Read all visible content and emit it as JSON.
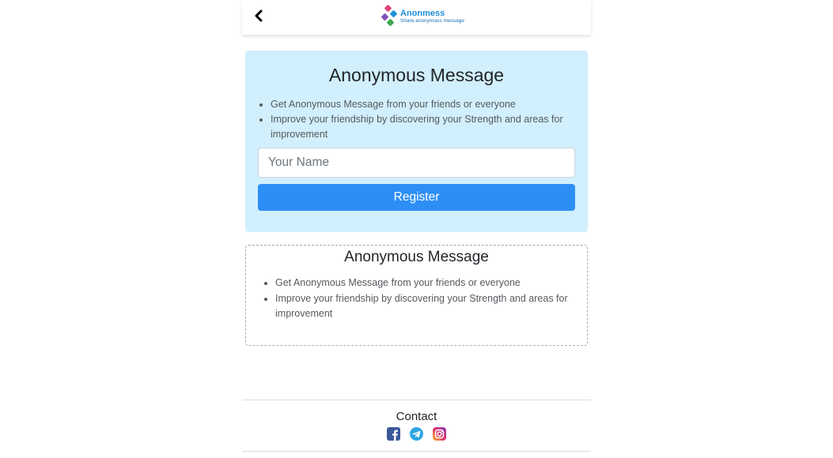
{
  "header": {
    "back_icon": "chevron-left-icon",
    "logo_name": "Anonmess",
    "logo_tagline": "Share anonymous message"
  },
  "register_card": {
    "title": "Anonymous Message",
    "bullets": [
      "Get Anonymous Message from your friends or everyone",
      "Improve your friendship by discovering your Strength and areas for improvement"
    ],
    "name_input": {
      "placeholder": "Your Name",
      "value": ""
    },
    "register_label": "Register",
    "background": "#d1effc",
    "button_color": "#2d8ff6"
  },
  "info_card": {
    "title": "Anonymous Message",
    "bullets": [
      "Get Anonymous Message from your friends or everyone",
      "Improve your friendship by discovering your Strength and areas for improvement"
    ]
  },
  "footer": {
    "contact_label": "Contact",
    "social": [
      {
        "name": "facebook",
        "icon": "facebook-icon",
        "color": "#3b5998"
      },
      {
        "name": "telegram",
        "icon": "telegram-icon",
        "color": "#2ca5e0"
      },
      {
        "name": "instagram",
        "icon": "instagram-icon",
        "color": "#e1306c"
      }
    ]
  }
}
